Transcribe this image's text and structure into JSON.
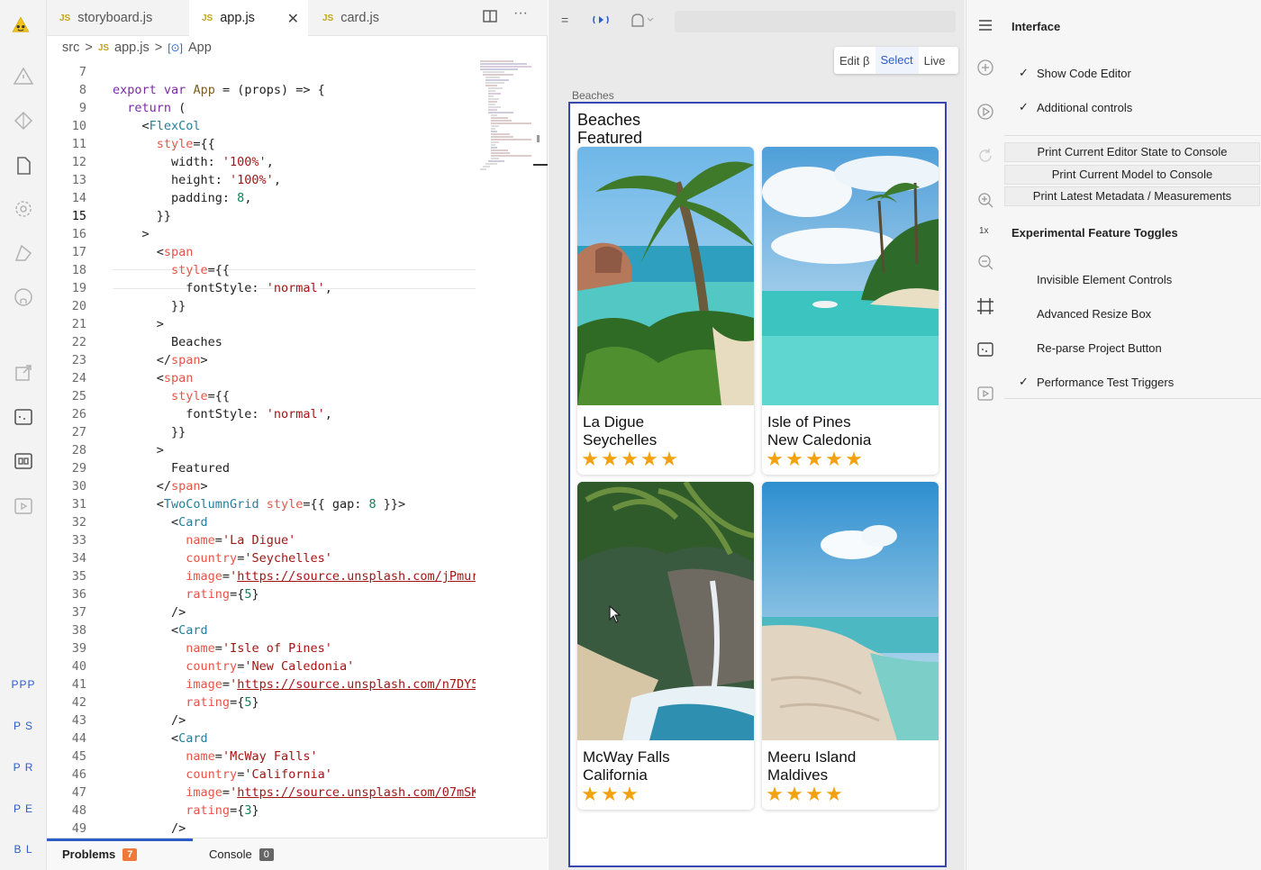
{
  "tabs": [
    {
      "label": "storyboard.js",
      "type": "JS"
    },
    {
      "label": "app.js",
      "type": "JS",
      "active": true
    },
    {
      "label": "card.js",
      "type": "JS"
    }
  ],
  "breadcrumb": {
    "src": "src",
    "sep": ">",
    "file": "app.js",
    "file_type": "JS",
    "symbol_icon": "[⊙]",
    "symbol": "App"
  },
  "activity_text": [
    "PPP",
    "P S",
    "P R",
    "P E",
    "B L"
  ],
  "code_lines": [
    {
      "n": 7,
      "html": ""
    },
    {
      "n": 8,
      "html": "<span class=\"k\">export</span> <span class=\"k\">var</span> <span class=\"f\">App</span> = (props) => {"
    },
    {
      "n": 9,
      "html": "  <span class=\"k\">return</span> ("
    },
    {
      "n": 10,
      "html": "    &lt;<span class=\"t\">FlexCol</span>"
    },
    {
      "n": 11,
      "html": "      <span class=\"a\">style</span>={{"
    },
    {
      "n": 12,
      "html": "        width: <span class=\"s\">'100%'</span>,"
    },
    {
      "n": 13,
      "html": "        height: <span class=\"s\">'100%'</span>,"
    },
    {
      "n": 14,
      "html": "        padding: <span class=\"n\">8</span>,"
    },
    {
      "n": 15,
      "html": "      }}",
      "current": true
    },
    {
      "n": 16,
      "html": "    >"
    },
    {
      "n": 17,
      "html": "      &lt;<span class=\"a\">span</span>"
    },
    {
      "n": 18,
      "html": "        <span class=\"a\">style</span>={{"
    },
    {
      "n": 19,
      "html": "          fontStyle: <span class=\"s\">'normal'</span>,"
    },
    {
      "n": 20,
      "html": "        }}"
    },
    {
      "n": 21,
      "html": "      >"
    },
    {
      "n": 22,
      "html": "        Beaches"
    },
    {
      "n": 23,
      "html": "      &lt;/<span class=\"a\">span</span>>"
    },
    {
      "n": 24,
      "html": "      &lt;<span class=\"a\">span</span>"
    },
    {
      "n": 25,
      "html": "        <span class=\"a\">style</span>={{"
    },
    {
      "n": 26,
      "html": "          fontStyle: <span class=\"s\">'normal'</span>,"
    },
    {
      "n": 27,
      "html": "        }}"
    },
    {
      "n": 28,
      "html": "      >"
    },
    {
      "n": 29,
      "html": "        Featured"
    },
    {
      "n": 30,
      "html": "      &lt;/<span class=\"a\">span</span>>"
    },
    {
      "n": 31,
      "html": "      &lt;<span class=\"t\">TwoColumnGrid</span> <span class=\"a\">style</span>={{ gap: <span class=\"n\">8</span> }}>"
    },
    {
      "n": 32,
      "html": "        &lt;<span class=\"t\">Card</span>"
    },
    {
      "n": 33,
      "html": "          <span class=\"a\">name</span>=<span class=\"s\">'La Digue'</span>"
    },
    {
      "n": 34,
      "html": "          <span class=\"a\">country</span>=<span class=\"s\">'Seychelles'</span>"
    },
    {
      "n": 35,
      "html": "          <span class=\"a\">image</span>=<span class=\"s\">'</span><span class=\"u\">https://source.unsplash.com/jPmur</span>"
    },
    {
      "n": 36,
      "html": "          <span class=\"a\">rating</span>={<span class=\"n\">5</span>}"
    },
    {
      "n": 37,
      "html": "        />"
    },
    {
      "n": 38,
      "html": "        &lt;<span class=\"t\">Card</span>"
    },
    {
      "n": 39,
      "html": "          <span class=\"a\">name</span>=<span class=\"s\">'Isle of Pines'</span>"
    },
    {
      "n": 40,
      "html": "          <span class=\"a\">country</span>=<span class=\"s\">'New Caledonia'</span>"
    },
    {
      "n": 41,
      "html": "          <span class=\"a\">image</span>=<span class=\"s\">'</span><span class=\"u\">https://source.unsplash.com/n7DY5</span>"
    },
    {
      "n": 42,
      "html": "          <span class=\"a\">rating</span>={<span class=\"n\">5</span>}"
    },
    {
      "n": 43,
      "html": "        />"
    },
    {
      "n": 44,
      "html": "        &lt;<span class=\"t\">Card</span>"
    },
    {
      "n": 45,
      "html": "          <span class=\"a\">name</span>=<span class=\"s\">'McWay Falls'</span>"
    },
    {
      "n": 46,
      "html": "          <span class=\"a\">country</span>=<span class=\"s\">'California'</span>"
    },
    {
      "n": 47,
      "html": "          <span class=\"a\">image</span>=<span class=\"s\">'</span><span class=\"u\">https://source.unsplash.com/07mSK</span>"
    },
    {
      "n": 48,
      "html": "          <span class=\"a\">rating</span>={<span class=\"n\">3</span>}"
    },
    {
      "n": 49,
      "html": "        />"
    }
  ],
  "bottom_panel": {
    "problems_label": "Problems",
    "problems_count": "7",
    "console_label": "Console",
    "console_count": "0"
  },
  "canvas": {
    "modes": [
      "Edit β",
      "Select",
      "Live"
    ],
    "scene_label": "Beaches",
    "title1": "Beaches",
    "title2": "Featured",
    "cards": [
      {
        "name": "La Digue",
        "country": "Seychelles",
        "rating": 5,
        "image": "palm-beach-rocks"
      },
      {
        "name": "Isle of Pines",
        "country": "New Caledonia",
        "rating": 5,
        "image": "lagoon-boat"
      },
      {
        "name": "McWay Falls",
        "country": "California",
        "rating": 3,
        "image": "cliff-waterfall"
      },
      {
        "name": "Meeru Island",
        "country": "Maldives",
        "rating": 4,
        "image": "sandbar-sea"
      }
    ]
  },
  "inspector": {
    "title": "Interface",
    "options": [
      {
        "label": "Show Code Editor",
        "checked": true
      },
      {
        "label": "Additional controls",
        "checked": true
      }
    ],
    "buttons": [
      "Print Current Editor State to Console",
      "Print Current Model to Console",
      "Print Latest Metadata / Measurements"
    ],
    "zoom_label": "1x",
    "experimental_title": "Experimental Feature Toggles",
    "toggles": [
      {
        "label": "Invisible Element Controls",
        "checked": false
      },
      {
        "label": "Advanced Resize Box",
        "checked": false
      },
      {
        "label": "Re-parse Project Button",
        "checked": false
      },
      {
        "label": "Performance Test Triggers",
        "checked": true
      }
    ]
  },
  "colors": {
    "accent": "#2c5cc5",
    "selection_outline": "#3548b0",
    "star": "#f2a20f",
    "problems_badge": "#f0793a",
    "console_badge": "#666666"
  }
}
